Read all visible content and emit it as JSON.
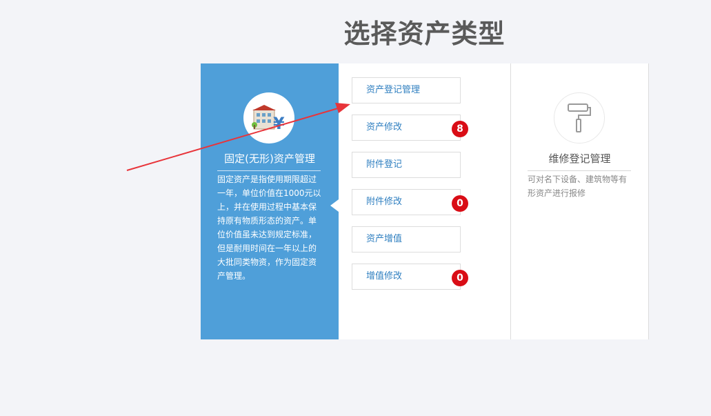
{
  "title": "选择资产类型",
  "left_card": {
    "icon": "building-yen-icon",
    "title": "固定(无形)资产管理",
    "description": "固定资产是指使用期限超过一年，单位价值在1000元以上，并在使用过程中基本保持原有物质形态的资产。单位价值虽未达到规定标准，但是耐用时间在一年以上的大批同类物资，作为固定资产管理。"
  },
  "menu": [
    {
      "label": "资产登记管理",
      "badge": null
    },
    {
      "label": "资产修改",
      "badge": "8"
    },
    {
      "label": "附件登记",
      "badge": null
    },
    {
      "label": "附件修改",
      "badge": "0"
    },
    {
      "label": "资产增值",
      "badge": null
    },
    {
      "label": "增值修改",
      "badge": "0"
    }
  ],
  "right_card": {
    "icon": "paint-roller-icon",
    "title": "维修登记管理",
    "description": "可对名下设备、建筑物等有形资产进行报修"
  },
  "colors": {
    "primary_blue": "#4f9fd9",
    "link_blue": "#2f7fc0",
    "badge_red": "#d90d16",
    "annotation_red": "#e8343a"
  }
}
